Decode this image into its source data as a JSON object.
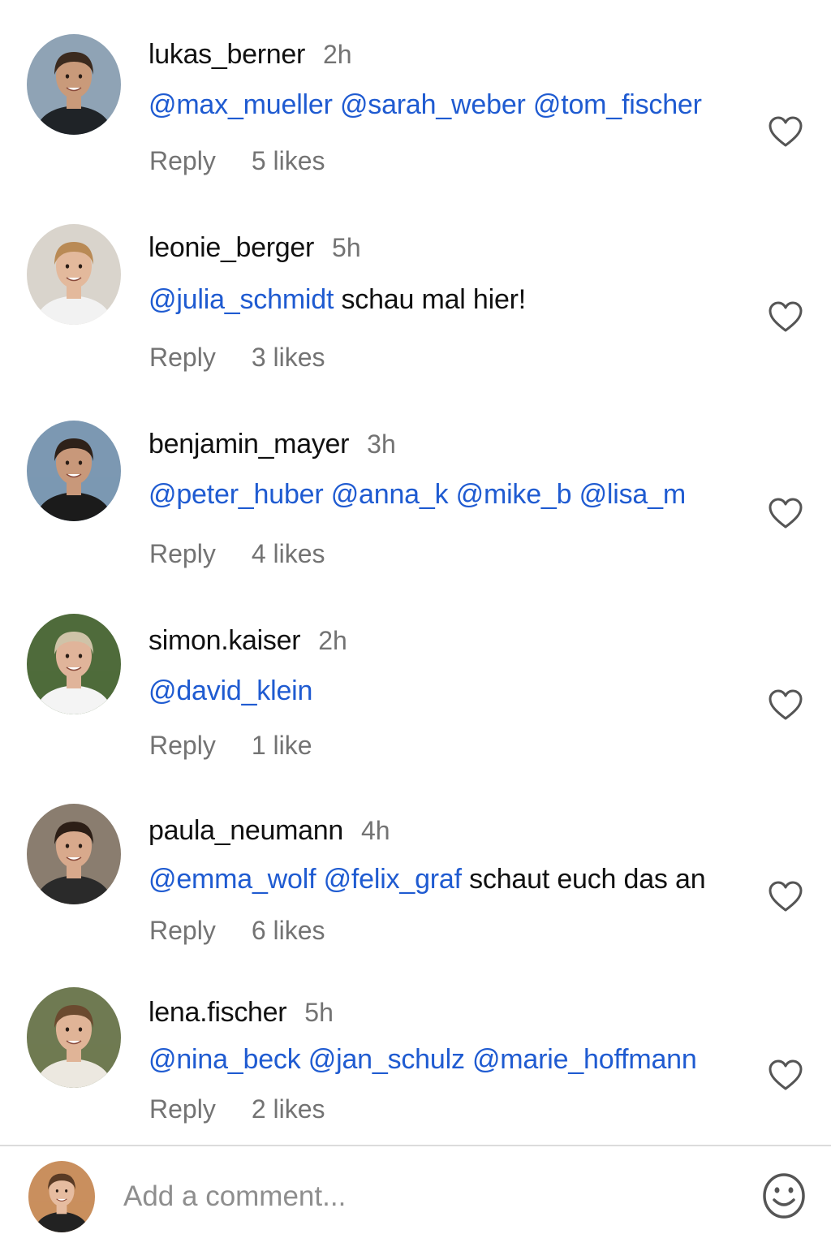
{
  "comments": [
    {
      "username": "lukas_berner",
      "time": "2h",
      "segments": [
        {
          "text": "@max_mueller @sarah_weber @tom_fischer",
          "type": "mention"
        }
      ],
      "reply_label": "Reply",
      "likes": "5 likes",
      "avatar": {
        "bg": "#8fa3b5",
        "skin": "#c99a7a",
        "hair": "#3b2a1e",
        "shirt": "#1f2327"
      }
    },
    {
      "username": "leonie_berger",
      "time": "5h",
      "segments": [
        {
          "text": "@julia_schmidt",
          "type": "mention"
        },
        {
          "text": " schau mal hier!",
          "type": "plain"
        }
      ],
      "reply_label": "Reply",
      "likes": "3 likes",
      "avatar": {
        "bg": "#d9d4cc",
        "skin": "#e3b99c",
        "hair": "#b98a55",
        "shirt": "#f2f2f2"
      }
    },
    {
      "username": "benjamin_mayer",
      "time": "3h",
      "segments": [
        {
          "text": "@peter_huber @anna_k @mike_b @lisa_m",
          "type": "mention"
        }
      ],
      "reply_label": "Reply",
      "likes": "4 likes",
      "avatar": {
        "bg": "#7c98b2",
        "skin": "#c8987a",
        "hair": "#2e2119",
        "shirt": "#1b1b1b"
      }
    },
    {
      "username": "simon.kaiser",
      "time": "2h",
      "segments": [
        {
          "text": "@david_klein",
          "type": "mention"
        }
      ],
      "reply_label": "Reply",
      "likes": "1 like",
      "avatar": {
        "bg": "#4f6b3b",
        "skin": "#e0b49a",
        "hair": "#cfc3a8",
        "shirt": "#f4f4f4"
      }
    },
    {
      "username": "paula_neumann",
      "time": "4h",
      "segments": [
        {
          "text": "@emma_wolf @felix_graf",
          "type": "mention"
        },
        {
          "text": " schaut euch das an",
          "type": "plain"
        }
      ],
      "reply_label": "Reply",
      "likes": "6 likes",
      "avatar": {
        "bg": "#8a7d6f",
        "skin": "#d8a98c",
        "hair": "#2c1e16",
        "shirt": "#2a2a2a"
      }
    },
    {
      "username": "lena.fischer",
      "time": "5h",
      "segments": [
        {
          "text": "@nina_beck @jan_schulz @marie_hoffmann",
          "type": "mention"
        }
      ],
      "reply_label": "Reply",
      "likes": "2 likes",
      "avatar": {
        "bg": "#6f7a52",
        "skin": "#e0b497",
        "hair": "#6b4a2f",
        "shirt": "#ece8e0"
      }
    }
  ],
  "composer": {
    "placeholder": "Add a comment...",
    "avatar": {
      "bg": "#c98f5e",
      "skin": "#e6bca0",
      "hair": "#5a3b25",
      "shirt": "#222222"
    }
  },
  "colors": {
    "mention": "#1f5bd1",
    "secondary_text": "#737373",
    "icon_stroke": "#555555",
    "divider": "#dbdbdb"
  },
  "icons": {
    "heart": "heart-icon",
    "emoji": "emoji-icon"
  }
}
